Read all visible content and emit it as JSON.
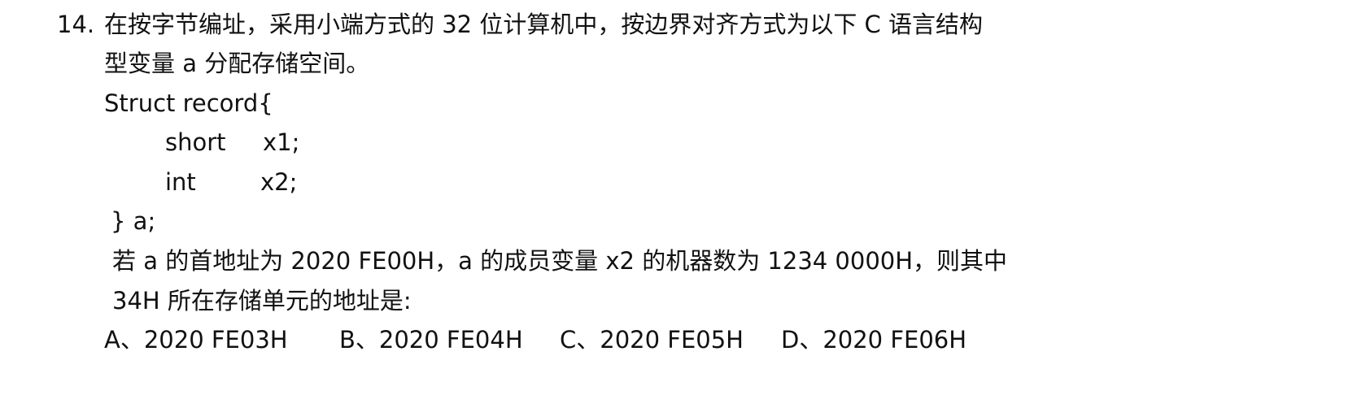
{
  "question": {
    "number": "14.",
    "stem_line1": "在按字节编址，采用小端方式的 32 位计算机中，按边界对齐方式为以下 C 语言结构",
    "stem_line2": "型变量 a 分配存储空间。",
    "code": {
      "open": "Struct record{",
      "field1_type": "short",
      "field1_name": "x1;",
      "field2_type": "int",
      "field2_name": "x2;",
      "close": "} a;"
    },
    "condition_line1": "若 a 的首地址为 2020 FE00H，a 的成员变量 x2 的机器数为 1234 0000H，则其中",
    "condition_line2": "34H 所在存储单元的地址是:",
    "options": [
      "A、2020 FE03H",
      "B、2020 FE04H",
      "C、2020 FE05H",
      "D、2020 FE06H"
    ]
  }
}
